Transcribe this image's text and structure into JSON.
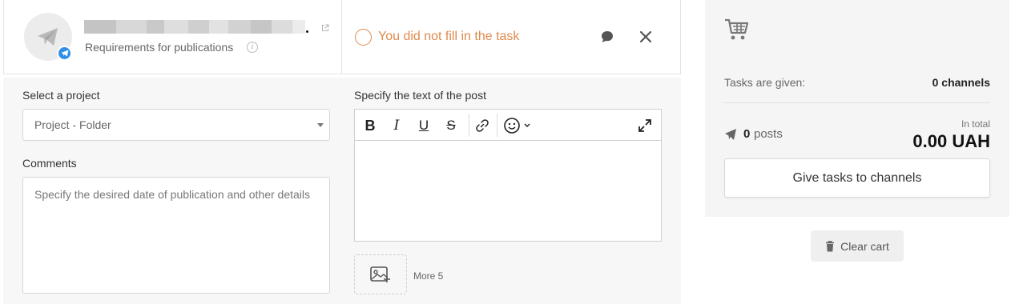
{
  "task": {
    "channel": {
      "name": "",
      "requirements_label": "Requirements for publications",
      "platform_icon": "telegram-icon"
    },
    "status": {
      "text": "You did not fill in the task",
      "color": "#e08a4c"
    },
    "project": {
      "label": "Select a project",
      "value": "Project - Folder"
    },
    "comments": {
      "label": "Comments",
      "placeholder": "Specify the desired date of publication and other details"
    },
    "post": {
      "label": "Specify the text of the post",
      "toolbar_icons": [
        "bold-icon",
        "italic-icon",
        "underline-icon",
        "strikethrough-icon",
        "link-icon",
        "emoji-icon",
        "expand-icon"
      ],
      "text": ""
    },
    "media": {
      "more_label": "More 5"
    }
  },
  "cart": {
    "tasks_given_label": "Tasks are given:",
    "tasks_given_value": "0 channels",
    "posts_count": "0",
    "posts_label": "posts",
    "total_label": "In total",
    "total_value": "0.00 UAH",
    "give_button": "Give tasks to channels",
    "clear_button": "Clear cart"
  },
  "colors": {
    "accent_orange": "#e08a4c",
    "telegram_blue": "#2f8ee5"
  }
}
